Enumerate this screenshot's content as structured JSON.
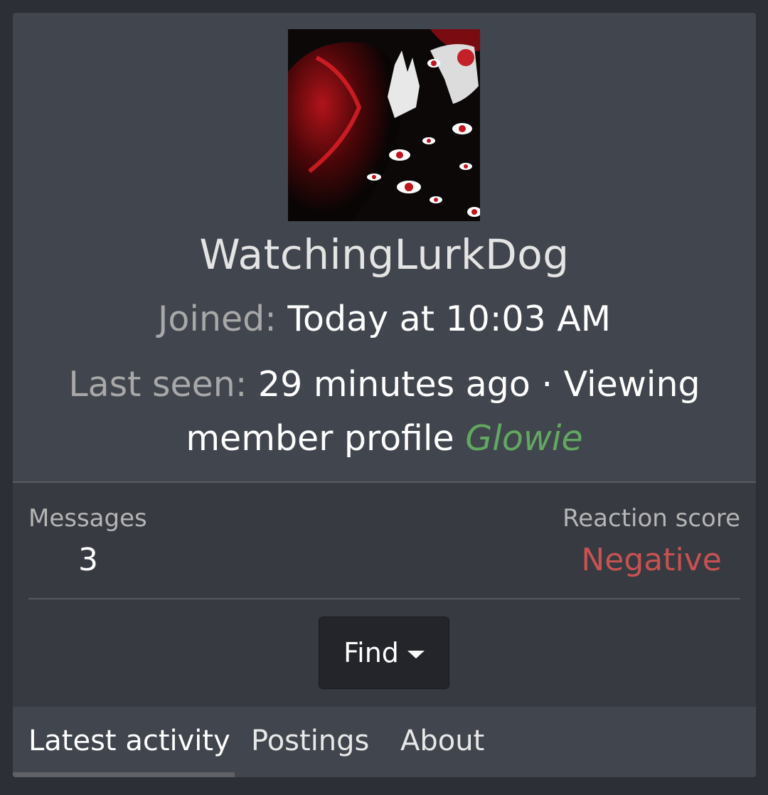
{
  "profile": {
    "username": "WatchingLurkDog",
    "joined_label": "Joined:",
    "joined_value": "Today at 10:03 AM",
    "last_seen_label": "Last seen:",
    "last_seen_value": "29 minutes ago · Viewing member profile",
    "banner": "Glowie",
    "avatar_icon": "avatar-image"
  },
  "stats": {
    "messages_label": "Messages",
    "messages_value": "3",
    "reaction_label": "Reaction score",
    "reaction_value": "Negative"
  },
  "actions": {
    "find_label": "Find"
  },
  "tabs": [
    {
      "label": "Latest activity"
    },
    {
      "label": "Postings"
    },
    {
      "label": "About"
    }
  ],
  "colors": {
    "card_bg": "#41454d",
    "stats_bg": "#373a41",
    "banner_green": "#62a860",
    "negative_red": "#c85252"
  }
}
